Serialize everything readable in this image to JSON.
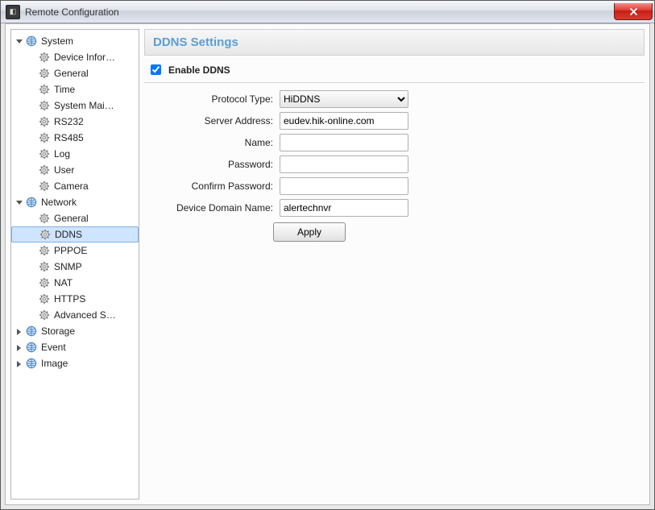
{
  "window": {
    "title": "Remote Configuration"
  },
  "sidebar": {
    "system": {
      "label": "System",
      "items": [
        "Device Infor…",
        "General",
        "Time",
        "System Mai…",
        "RS232",
        "RS485",
        "Log",
        "User",
        "Camera"
      ]
    },
    "network": {
      "label": "Network",
      "items": [
        "General",
        "DDNS",
        "PPPOE",
        "SNMP",
        "NAT",
        "HTTPS",
        "Advanced S…"
      ]
    },
    "storage": {
      "label": "Storage"
    },
    "event": {
      "label": "Event"
    },
    "image": {
      "label": "Image"
    }
  },
  "main": {
    "heading": "DDNS Settings",
    "enable_checked": true,
    "enable_label": "Enable DDNS",
    "fields": {
      "protocol_label": "Protocol Type:",
      "protocol_value": "HiDDNS",
      "server_label": "Server Address:",
      "server_value": "eudev.hik-online.com",
      "name_label": "Name:",
      "name_value": "",
      "password_label": "Password:",
      "password_value": "",
      "confirm_label": "Confirm Password:",
      "confirm_value": "",
      "domain_label": "Device Domain Name:",
      "domain_value": "alertechnvr"
    },
    "apply_label": "Apply"
  }
}
